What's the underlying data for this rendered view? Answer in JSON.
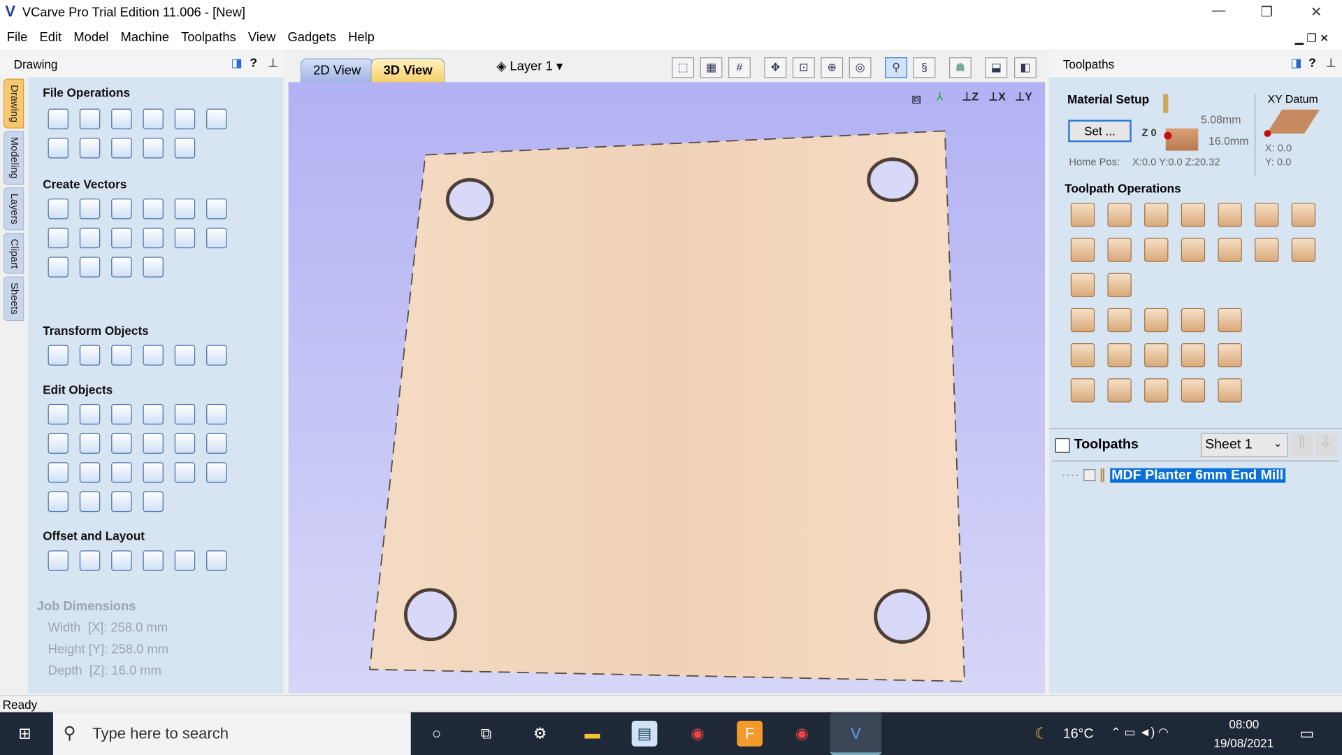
{
  "window": {
    "title": "VCarve Pro Trial Edition 11.006 - [New]",
    "minimize": "—",
    "restore": "❐",
    "close": "✕"
  },
  "menu": [
    "File",
    "Edit",
    "Model",
    "Machine",
    "Toolpaths",
    "View",
    "Gadgets",
    "Help"
  ],
  "left_panel": {
    "title": "Drawing",
    "side_tabs": [
      "Drawing",
      "Modeling",
      "Layers",
      "Clipart",
      "Sheets"
    ],
    "sections": [
      {
        "title": "File Operations",
        "icons": [
          "new-file-icon",
          "open-file-icon",
          "save-icon",
          "open-folder-icon",
          "import-icon",
          "select-all-icon",
          "cut-icon",
          "copy-icon",
          "paste-icon",
          "undo-icon",
          "redo-icon"
        ]
      },
      {
        "title": "Create Vectors",
        "icons": [
          "circle-icon",
          "ellipse-icon",
          "rectangle-icon",
          "polygon-icon",
          "star-icon",
          "polyline-icon",
          "arc-icon",
          "curve-icon",
          "spiral-icon",
          "text-icon",
          "text-box-icon",
          "text-on-curve-icon",
          "autoscale-text-icon",
          "arc-text-icon",
          "bitmap-trace-icon",
          "dimension-icon"
        ]
      },
      {
        "title": "Transform Objects",
        "icons": [
          "move-icon",
          "scale-icon",
          "align-icon",
          "mirror-icon",
          "distort-icon",
          "set-origin-icon"
        ]
      },
      {
        "title": "Edit Objects",
        "icons": [
          "select-icon",
          "node-edit-icon",
          "transform-select-icon",
          "group-icon",
          "ungroup-icon",
          "measure-icon",
          "weld-icon",
          "subtract-icon",
          "intersect-icon",
          "trim-icon",
          "scissors-icon",
          "fillet-icon",
          "chamfer-icon",
          "join-icon",
          "smooth-icon",
          "close-vector-icon",
          "edit-bitmap-icon",
          "offset-merge-icon",
          "curve-fit-icon",
          "extend-icon",
          "line-icon",
          "bend-icon"
        ]
      },
      {
        "title": "Offset and Layout",
        "icons": [
          "offset-icon",
          "array-icon",
          "circular-array-icon",
          "copy-along-icon",
          "nesting-icon",
          "fit-icon"
        ]
      }
    ],
    "job_dimensions": {
      "title": "Job Dimensions",
      "width": "Width  [X]: 258.0 mm",
      "height": "Height [Y]: 258.0 mm",
      "depth": "Depth  [Z]: 16.0 mm"
    }
  },
  "view": {
    "tabs": [
      "2D View",
      "3D View"
    ],
    "active_tab": "3D View",
    "layer": "Layer 1"
  },
  "right_panel": {
    "title": "Toolpaths",
    "material_setup": {
      "title": "Material Setup",
      "set_button": "Set ...",
      "z0": "Z 0",
      "clearance": "5.08mm",
      "thickness": "16.0mm",
      "home_pos_label": "Home Pos:",
      "home_pos": "X:0.0 Y:0.0 Z:20.32",
      "xy_datum": "XY Datum",
      "x": "X: 0.0",
      "y": "Y: 0.0"
    },
    "operations_title": "Toolpath Operations",
    "operations": [
      "profile-toolpath-icon",
      "pocket-toolpath-icon",
      "drilling-toolpath-icon",
      "inlay-toolpath-icon",
      "quick-engrave-icon",
      "texture-toolpath-icon",
      "vcarve-toolpath-icon",
      "fluting-icon",
      "prism-icon",
      "moulding-icon",
      "chamfer-toolpath-icon",
      "3d-roughing-icon",
      "3d-finishing-icon",
      "3d-profile-icon",
      "project-toolpath-icon",
      "sphere-icon",
      "tool-database-icon",
      "edit-toolpath-icon",
      "save-toolpath-icon",
      "delete-toolpath-icon",
      "summary-icon",
      "preview-selected-icon",
      "preview-all-icon",
      "preview-material-icon",
      "merge-toolpath-icon",
      "material-icon",
      "toolpath-template-icon",
      "time-estimate-icon",
      "tool-compare-icon",
      "toolpath-settings-icon",
      "save-template-icon"
    ],
    "list": {
      "header": "Toolpaths",
      "sheet": "Sheet 1",
      "items": [
        "MDF Planter 6mm End Mill"
      ]
    }
  },
  "status": "Ready",
  "taskbar": {
    "search_placeholder": "Type here to search",
    "temperature": "16°C",
    "time": "08:00",
    "date": "19/08/2021"
  }
}
